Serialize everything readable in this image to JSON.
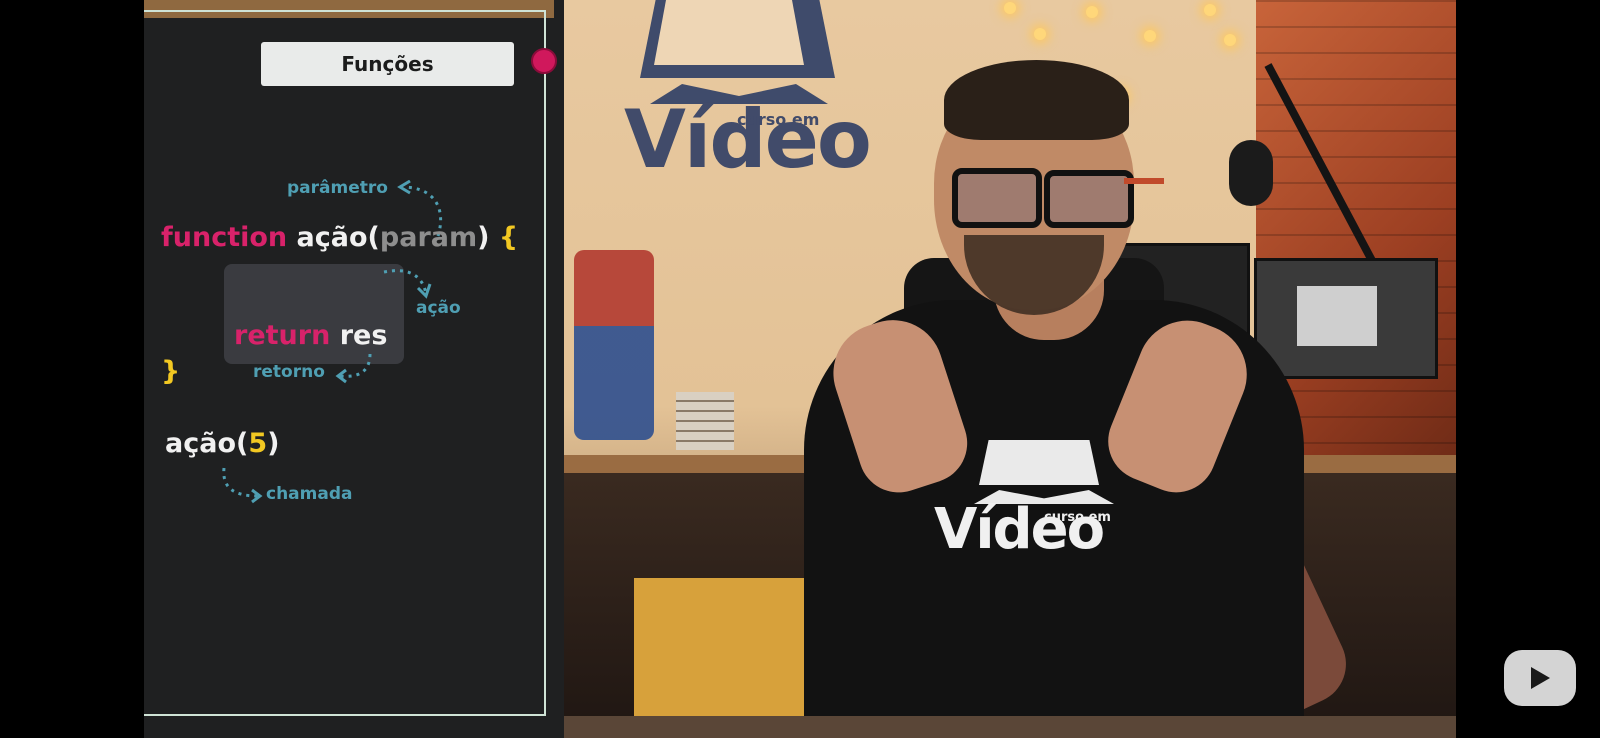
{
  "board": {
    "title": "Funções",
    "code_line1": {
      "keyword": "function",
      "name": "ação(",
      "param": "param",
      "close": ")",
      "brace_open": "{"
    },
    "code_line2": {
      "keyword": "return",
      "value": "res"
    },
    "brace_close": "}",
    "call": {
      "name": "ação(",
      "arg": "5",
      "close": ")"
    },
    "notes": {
      "parametro": "parâmetro",
      "acao": "ação",
      "retorno": "retorno",
      "chamada": "chamada"
    }
  },
  "wall_logo": {
    "word": "Vídeo",
    "sub": "curso em"
  },
  "shirt_logo": {
    "word": "Vídeo",
    "sub": "curso em"
  },
  "colors": {
    "keyword": "#d8226a",
    "annotation": "#4f9fb3",
    "number": "#f2c822",
    "record_dot": "#d0185c"
  },
  "controls": {
    "play_icon": "play-icon"
  }
}
